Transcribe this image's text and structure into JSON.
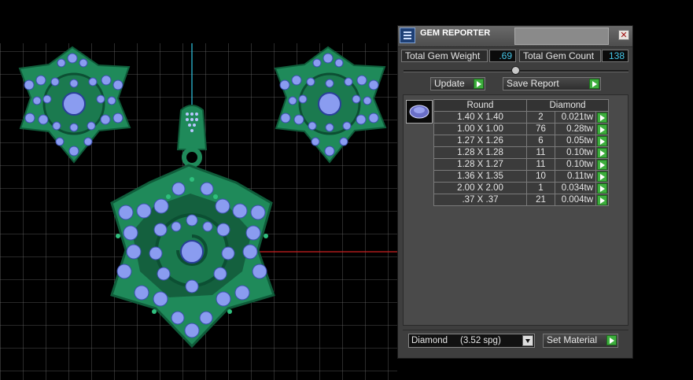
{
  "panel": {
    "title": "GEM REPORTER",
    "close_glyph": "✕",
    "total_gem_weight_label": "Total Gem Weight",
    "total_gem_weight_value": ".69",
    "total_gem_count_label": "Total Gem Count",
    "total_gem_count_value": "138",
    "update_label": "Update",
    "save_report_label": "Save Report",
    "table": {
      "headers": [
        "Round",
        "Diamond"
      ],
      "rows": [
        {
          "size": "1.40 X 1.40",
          "count": "2",
          "tw": "0.021tw"
        },
        {
          "size": "1.00 X 1.00",
          "count": "76",
          "tw": "0.28tw"
        },
        {
          "size": "1.27 X 1.26",
          "count": "6",
          "tw": "0.05tw"
        },
        {
          "size": "1.28 X 1.28",
          "count": "11",
          "tw": "0.10tw"
        },
        {
          "size": "1.28 X 1.27",
          "count": "11",
          "tw": "0.10tw"
        },
        {
          "size": "1.36 X 1.35",
          "count": "10",
          "tw": "0.11tw"
        },
        {
          "size": "2.00 X 2.00",
          "count": "1",
          "tw": "0.034tw"
        },
        {
          "size": ".37 X .37",
          "count": "21",
          "tw": "0.004tw"
        }
      ]
    },
    "material_select": "Diamond     (3.52 spg)",
    "set_material_label": "Set Material"
  },
  "colors": {
    "metal_green": "#1f8a5a",
    "gem_blue": "#8a9cf0",
    "accent_cyan": "#45c6e8",
    "play_green": "#3dae3d"
  }
}
